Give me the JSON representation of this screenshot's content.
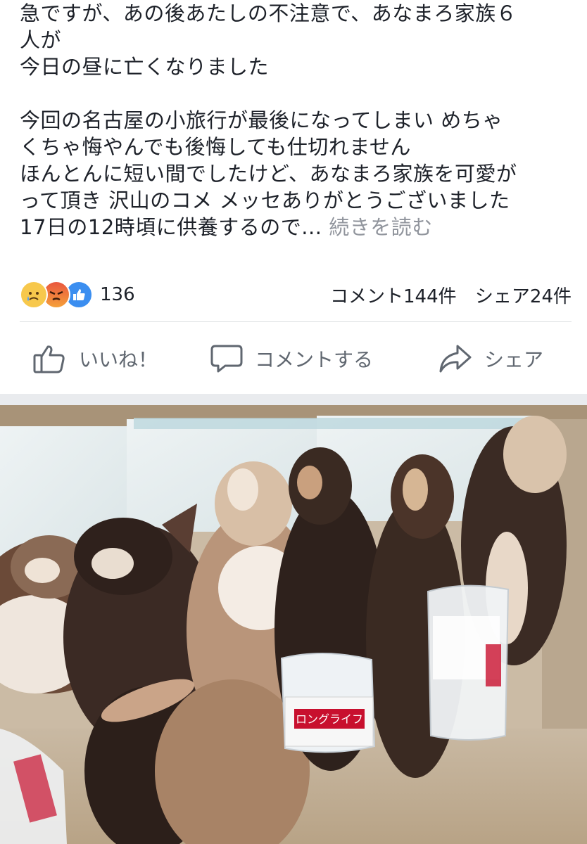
{
  "post": {
    "line1": "急ですが、あの後あたしの不注意で、あなまろ家族６",
    "line2": "人が",
    "line3": "今日の昼に亡くなりました",
    "para2_line1": "今回の名古屋の小旅行が最後になってしまい めちゃ",
    "para2_line2": "くちゃ悔やんでも後悔しても仕切れません",
    "para2_line3": "ほんとんに短い間でしたけど、あなまろ家族を可愛が",
    "para2_line4": "って頂き 沢山のコメ メッセありがとうございました",
    "para2_line5": "17日の12時頃に供養するので...",
    "see_more": "続きを読む"
  },
  "reactions": {
    "icons": [
      "sad-reaction-icon",
      "angry-reaction-icon",
      "like-reaction-icon"
    ],
    "count": "136",
    "comments": "コメント144件",
    "shares": "シェア24件"
  },
  "actions": {
    "like": "いいね！",
    "comment": "コメントする",
    "share": "シェア"
  },
  "photo": {
    "package_label": "ロングライフ"
  },
  "colors": {
    "text": "#1d2129",
    "muted": "#90949c",
    "action": "#606770",
    "like_blue": "#3b8ef0",
    "divider": "#dddfe2"
  }
}
